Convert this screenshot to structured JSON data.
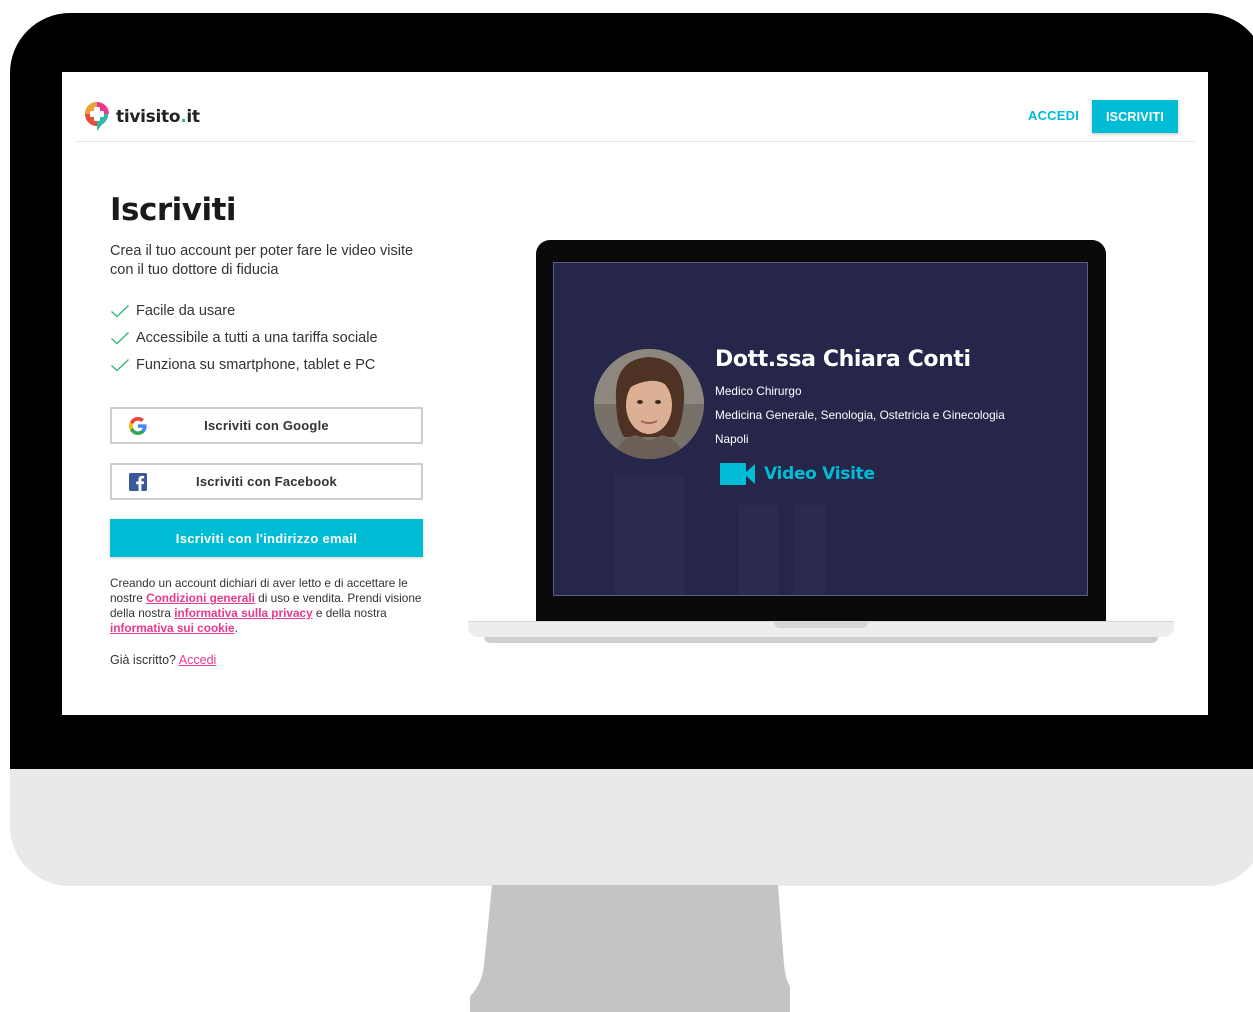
{
  "brand": {
    "logo_prefix": "tivisito",
    "logo_dot": ".",
    "logo_suffix": "it",
    "accent_color": "#00bcd4",
    "link_color": "#e8398f"
  },
  "nav": {
    "login_label": "ACCEDI",
    "signup_label": "ISCRIVITI"
  },
  "signup": {
    "title": "Iscriviti",
    "intro": "Crea il tuo account per poter fare le video visite con il tuo dottore di fiducia",
    "features": [
      "Facile da usare",
      "Accessibile a tutti a una tariffa sociale",
      "Funziona su smartphone, tablet e PC"
    ],
    "google_button": "Iscriviti con Google",
    "facebook_button": "Iscriviti con Facebook",
    "email_button": "Iscriviti con l'indirizzo email",
    "terms": {
      "part1": "Creando un account dichiari di aver letto e di accettare le nostre ",
      "link_conditions": "Condizioni generali",
      "part2": " di uso e vendita. Prendi visione della nostra ",
      "link_privacy": "informativa sulla privacy",
      "part3": " e della nostra ",
      "link_cookie": "informativa sui cookie",
      "part4": "."
    },
    "already_text": "Già iscritto? ",
    "already_link": "Accedi"
  },
  "doctor_card": {
    "name": "Dott.ssa Chiara Conti",
    "role": "Medico Chirurgo",
    "specialties": "Medicina Generale, Senologia, Ostetricia e Ginecologia",
    "city": "Napoli",
    "video_label": "Video Visite"
  },
  "icons": {
    "logo": "medical-cross-chat-icon",
    "check": "check-icon",
    "google": "google-icon",
    "facebook": "facebook-icon",
    "video": "video-camera-icon"
  }
}
